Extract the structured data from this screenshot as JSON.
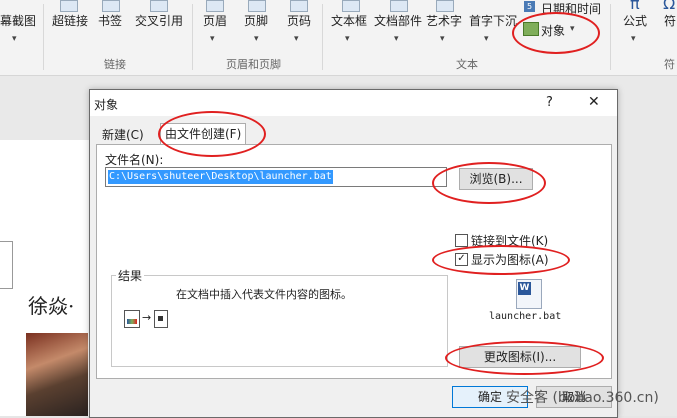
{
  "ribbon": {
    "buttons": [
      {
        "label": "幕截图"
      },
      {
        "label": "超链接"
      },
      {
        "label": "书签"
      },
      {
        "label": "交叉引用"
      },
      {
        "label": "页眉"
      },
      {
        "label": "页脚"
      },
      {
        "label": "页码"
      },
      {
        "label": "文本框"
      },
      {
        "label": "文档部件"
      },
      {
        "label": "艺术字"
      },
      {
        "label": "首字下沉"
      },
      {
        "label": "日期和时间"
      },
      {
        "label": "对象"
      },
      {
        "label": "公式"
      },
      {
        "label": "符"
      }
    ],
    "groups": {
      "links": "链接",
      "header_footer": "页眉和页脚",
      "text": "文本",
      "symbols": "符"
    },
    "dropdown_glyph": "▾"
  },
  "document": {
    "text": "徐焱·"
  },
  "dialog": {
    "title": "对象",
    "help": "?",
    "close": "✕",
    "tabs": [
      {
        "label": "新建(C)"
      },
      {
        "label": "由文件创建(F)"
      }
    ],
    "filename_label": "文件名(N):",
    "filename_value": "C:\\Users\\shuteer\\Desktop\\launcher.bat",
    "browse": "浏览(B)...",
    "link_to_file": "链接到文件(K)",
    "display_as_icon": "显示为图标(A)",
    "display_as_icon_checked": true,
    "result_label": "结果",
    "result_text": "在文档中插入代表文件内容的图标。",
    "icon_caption": "launcher.bat",
    "change_icon": "更改图标(I)...",
    "ok": "确定",
    "cancel": "取消"
  },
  "watermark": "安全客 (bobao.360.cn)",
  "colors": {
    "annotation": "#e02020",
    "accent": "#2b579a",
    "selection": "#3399ff"
  }
}
